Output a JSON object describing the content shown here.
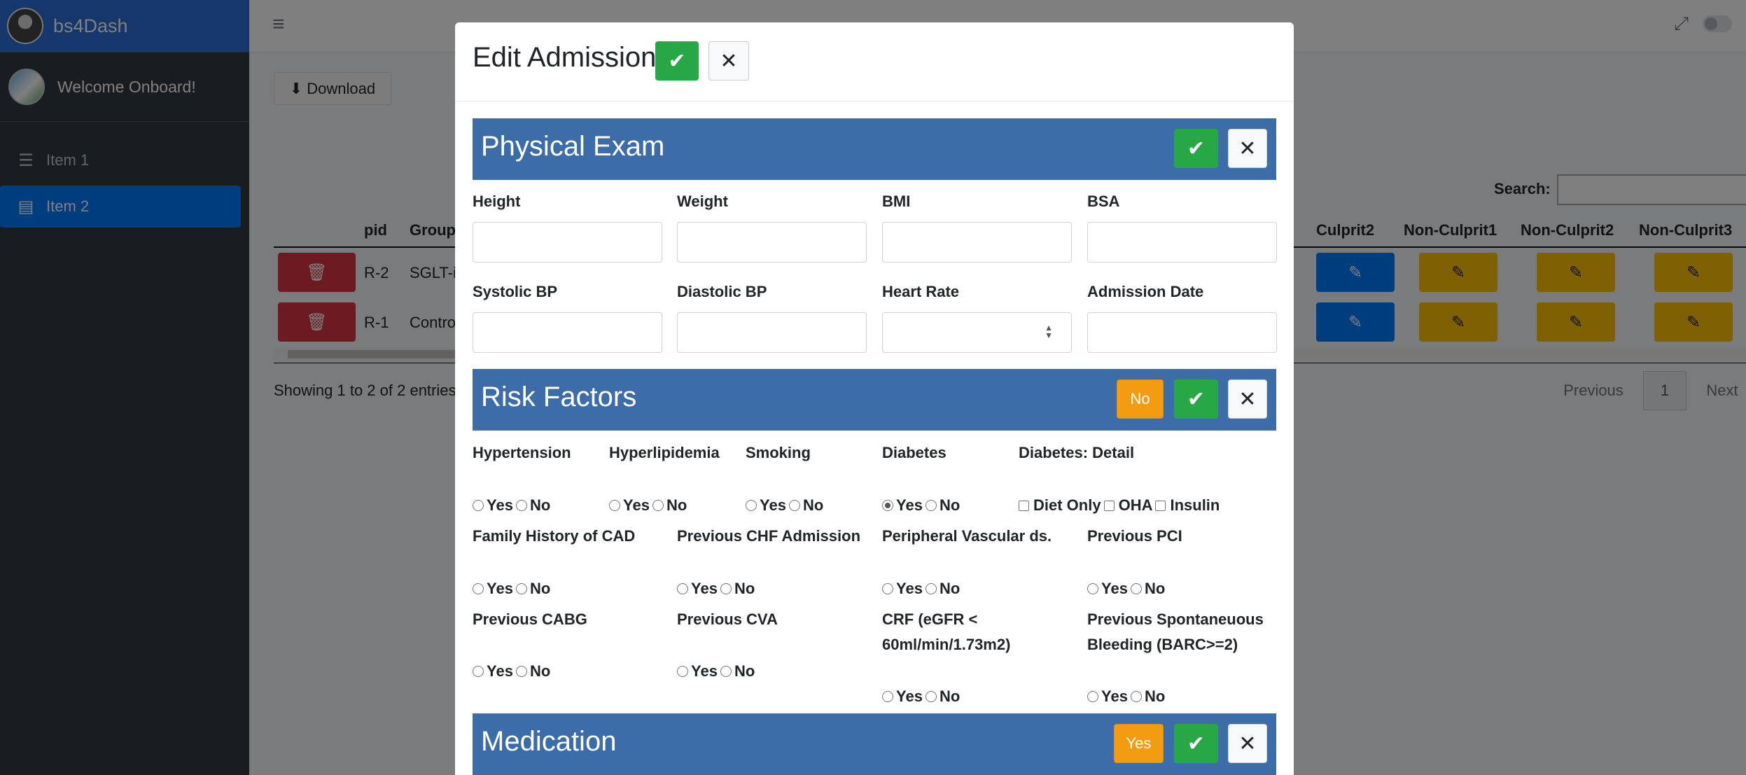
{
  "app": {
    "brand": "bs4Dash",
    "user": "Welcome Onboard!"
  },
  "sidebar": {
    "items": [
      {
        "label": "Item 1",
        "icon": "sliders-icon"
      },
      {
        "label": "Item 2",
        "icon": "id-card-icon"
      }
    ]
  },
  "toolbar": {
    "download": "Download"
  },
  "table": {
    "search_label": "Search:",
    "headers": [
      "pid",
      "Group",
      "Culprit2",
      "Non-Culprit1",
      "Non-Culprit2",
      "Non-Culprit3"
    ],
    "rows": [
      {
        "pid": "R-2",
        "group": "SGLT-i"
      },
      {
        "pid": "R-1",
        "group": "Contro"
      }
    ],
    "info": "Showing 1 to 2 of 2 entries",
    "pagination": {
      "previous": "Previous",
      "page": "1",
      "next": "Next"
    }
  },
  "modal": {
    "title": "Edit Admission",
    "physical_exam": {
      "title": "Physical Exam",
      "fields": [
        "Height",
        "Weight",
        "BMI",
        "BSA",
        "Systolic BP",
        "Diastolic BP",
        "Heart Rate",
        "Admission Date"
      ]
    },
    "risk_factors": {
      "title": "Risk Factors",
      "toggle": "No",
      "yes": "Yes",
      "no": "No",
      "items": [
        {
          "label": "Hypertension"
        },
        {
          "label": "Hyperlipidemia"
        },
        {
          "label": "Smoking"
        },
        {
          "label": "Diabetes",
          "selected": "Yes"
        },
        {
          "label": "Family History of CAD"
        },
        {
          "label": "Previous CHF Admission"
        },
        {
          "label": "Peripheral Vascular ds."
        },
        {
          "label": "Previous PCI"
        },
        {
          "label": "Previous CABG"
        },
        {
          "label": "Previous CVA"
        },
        {
          "label": "CRF (eGFR <",
          "label2": "60ml/min/1.73m2)"
        },
        {
          "label": "Previous Spontaneuous",
          "label2": "Bleeding (BARC>=2)"
        }
      ],
      "diabetes_detail": {
        "label": "Diabetes: Detail",
        "options": [
          "Diet Only",
          "OHA",
          "Insulin"
        ]
      }
    },
    "medication": {
      "title": "Medication",
      "toggle": "Yes"
    }
  }
}
